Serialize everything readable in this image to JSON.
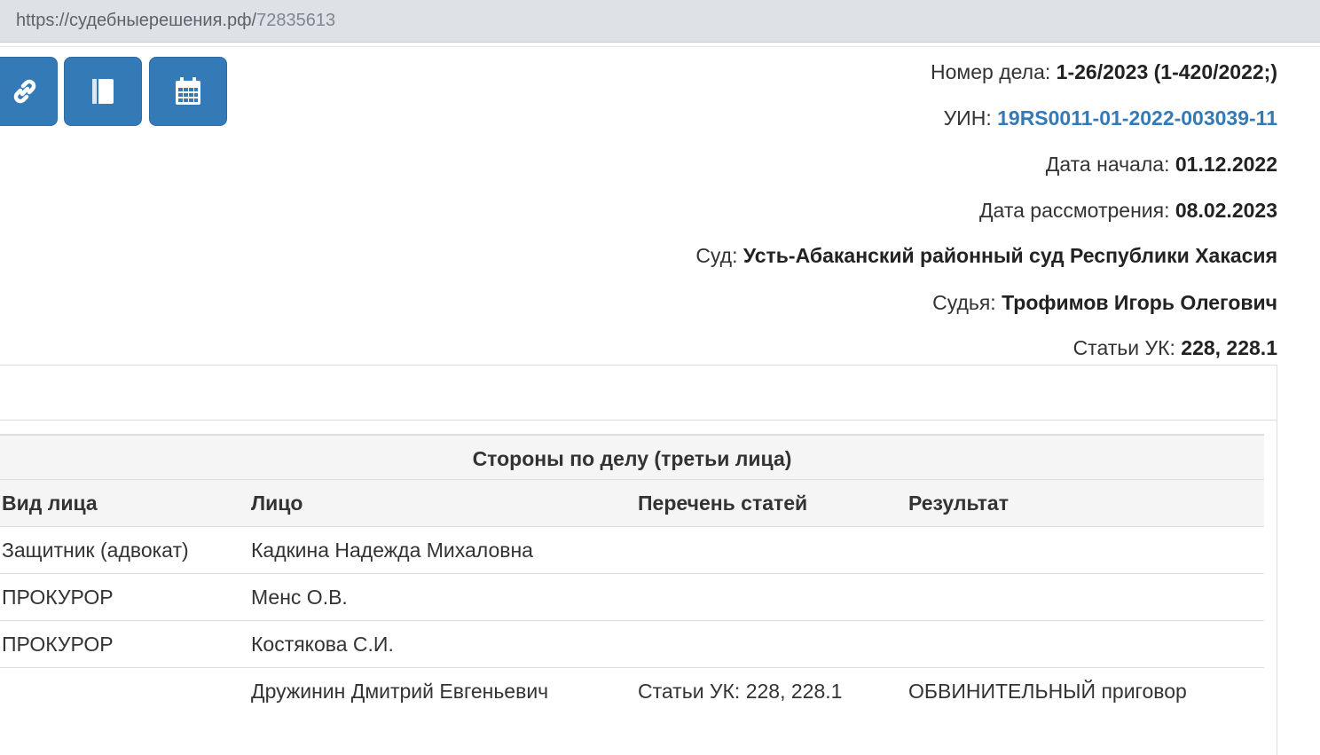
{
  "browser": {
    "url_host": "https://судебныерешения.рф/",
    "url_path": "72835613"
  },
  "toolbar": {
    "buttons": [
      {
        "icon": "link-icon"
      },
      {
        "icon": "book-icon"
      },
      {
        "icon": "calendar-icon"
      }
    ],
    "accent_color": "#337ab7"
  },
  "case": {
    "number_label": "Номер дела:",
    "number_value": "1-26/2023 (1-420/2022;)",
    "uin_label": "УИН:",
    "uin_value": "19RS0011-01-2022-003039-11",
    "start_label": "Дата начала:",
    "start_value": "01.12.2022",
    "review_label": "Дата рассмотрения:",
    "review_value": "08.02.2023",
    "court_label": "Суд:",
    "court_value": "Усть-Абаканский районный суд Республики Хакасия",
    "judge_label": "Судья:",
    "judge_value": "Трофимов Игорь Олегович",
    "articles_label": "Статьи УК:",
    "articles_value": "228, 228.1"
  },
  "parties": {
    "caption": "Стороны по делу (третьи лица)",
    "headers": [
      "Вид лица",
      "Лицо",
      "Перечень статей",
      "Результат"
    ],
    "rows": [
      [
        "Защитник (адвокат)",
        "Кадкина Надежда Михаловна",
        "",
        ""
      ],
      [
        "ПРОКУРОР",
        "Менс О.В.",
        "",
        ""
      ],
      [
        "ПРОКУРОР",
        "Костякова С.И.",
        "",
        ""
      ],
      [
        "",
        "Дружинин Дмитрий Евгеньевич",
        "Статьи УК: 228, 228.1",
        "ОБВИНИТЕЛЬНЫЙ приговор"
      ]
    ]
  }
}
